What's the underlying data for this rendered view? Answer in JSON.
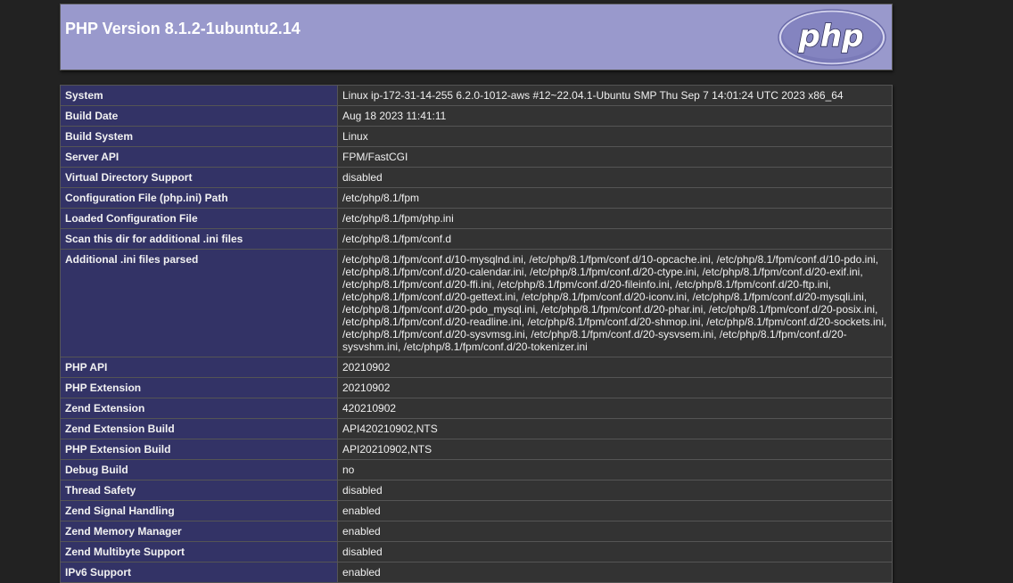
{
  "header": {
    "title": "PHP Version 8.1.2-1ubuntu2.14",
    "logo_text": "php"
  },
  "rows": [
    {
      "key": "System",
      "value": "Linux ip-172-31-14-255 6.2.0-1012-aws #12~22.04.1-Ubuntu SMP Thu Sep 7 14:01:24 UTC 2023 x86_64"
    },
    {
      "key": "Build Date",
      "value": "Aug 18 2023 11:41:11"
    },
    {
      "key": "Build System",
      "value": "Linux"
    },
    {
      "key": "Server API",
      "value": "FPM/FastCGI"
    },
    {
      "key": "Virtual Directory Support",
      "value": "disabled"
    },
    {
      "key": "Configuration File (php.ini) Path",
      "value": "/etc/php/8.1/fpm"
    },
    {
      "key": "Loaded Configuration File",
      "value": "/etc/php/8.1/fpm/php.ini"
    },
    {
      "key": "Scan this dir for additional .ini files",
      "value": "/etc/php/8.1/fpm/conf.d"
    },
    {
      "key": "Additional .ini files parsed",
      "value": "/etc/php/8.1/fpm/conf.d/10-mysqlnd.ini, /etc/php/8.1/fpm/conf.d/10-opcache.ini, /etc/php/8.1/fpm/conf.d/10-pdo.ini, /etc/php/8.1/fpm/conf.d/20-calendar.ini, /etc/php/8.1/fpm/conf.d/20-ctype.ini, /etc/php/8.1/fpm/conf.d/20-exif.ini, /etc/php/8.1/fpm/conf.d/20-ffi.ini, /etc/php/8.1/fpm/conf.d/20-fileinfo.ini, /etc/php/8.1/fpm/conf.d/20-ftp.ini, /etc/php/8.1/fpm/conf.d/20-gettext.ini, /etc/php/8.1/fpm/conf.d/20-iconv.ini, /etc/php/8.1/fpm/conf.d/20-mysqli.ini, /etc/php/8.1/fpm/conf.d/20-pdo_mysql.ini, /etc/php/8.1/fpm/conf.d/20-phar.ini, /etc/php/8.1/fpm/conf.d/20-posix.ini, /etc/php/8.1/fpm/conf.d/20-readline.ini, /etc/php/8.1/fpm/conf.d/20-shmop.ini, /etc/php/8.1/fpm/conf.d/20-sockets.ini, /etc/php/8.1/fpm/conf.d/20-sysvmsg.ini, /etc/php/8.1/fpm/conf.d/20-sysvsem.ini, /etc/php/8.1/fpm/conf.d/20-sysvshm.ini, /etc/php/8.1/fpm/conf.d/20-tokenizer.ini"
    },
    {
      "key": "PHP API",
      "value": "20210902"
    },
    {
      "key": "PHP Extension",
      "value": "20210902"
    },
    {
      "key": "Zend Extension",
      "value": "420210902"
    },
    {
      "key": "Zend Extension Build",
      "value": "API420210902,NTS"
    },
    {
      "key": "PHP Extension Build",
      "value": "API20210902,NTS"
    },
    {
      "key": "Debug Build",
      "value": "no"
    },
    {
      "key": "Thread Safety",
      "value": "disabled"
    },
    {
      "key": "Zend Signal Handling",
      "value": "enabled"
    },
    {
      "key": "Zend Memory Manager",
      "value": "enabled"
    },
    {
      "key": "Zend Multibyte Support",
      "value": "disabled"
    },
    {
      "key": "IPv6 Support",
      "value": "enabled"
    }
  ],
  "colors": {
    "header_bg": "#9999cc",
    "key_bg": "#333366",
    "value_bg": "#333333",
    "page_bg": "#222222"
  }
}
